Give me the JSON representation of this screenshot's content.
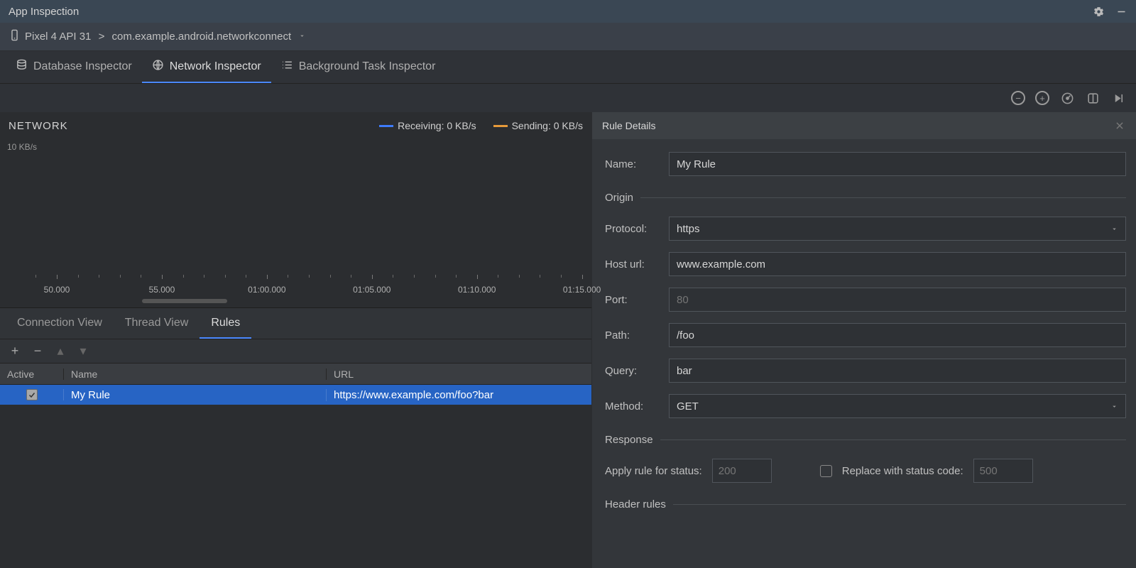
{
  "window": {
    "title": "App Inspection"
  },
  "breadcrumb": {
    "device": "Pixel 4 API 31",
    "app": "com.example.android.networkconnect"
  },
  "tabs": {
    "database": "Database Inspector",
    "network": "Network Inspector",
    "background": "Background Task Inspector",
    "active": "network"
  },
  "network": {
    "title": "NETWORK",
    "yaxis": "10 KB/s",
    "legend": {
      "receiving": "Receiving: 0 KB/s",
      "sending": "Sending: 0 KB/s"
    },
    "timeline_labels": [
      "50.000",
      "55.000",
      "01:00.000",
      "01:05.000",
      "01:10.000",
      "01:15.000"
    ]
  },
  "subtabs": {
    "connection": "Connection View",
    "thread": "Thread View",
    "rules": "Rules",
    "active": "rules"
  },
  "rules_table": {
    "headers": {
      "active": "Active",
      "name": "Name",
      "url": "URL"
    },
    "rows": [
      {
        "active": true,
        "name": "My Rule",
        "url": "https://www.example.com/foo?bar"
      }
    ]
  },
  "details": {
    "title": "Rule Details",
    "name_label": "Name:",
    "name_value": "My Rule",
    "origin_label": "Origin",
    "protocol_label": "Protocol:",
    "protocol_value": "https",
    "host_label": "Host url:",
    "host_value": "www.example.com",
    "port_label": "Port:",
    "port_placeholder": "80",
    "path_label": "Path:",
    "path_value": "/foo",
    "query_label": "Query:",
    "query_value": "bar",
    "method_label": "Method:",
    "method_value": "GET",
    "response_label": "Response",
    "apply_status_label": "Apply rule for status:",
    "apply_status_placeholder": "200",
    "replace_status_label": "Replace with status code:",
    "replace_status_placeholder": "500",
    "header_rules_label": "Header rules"
  }
}
